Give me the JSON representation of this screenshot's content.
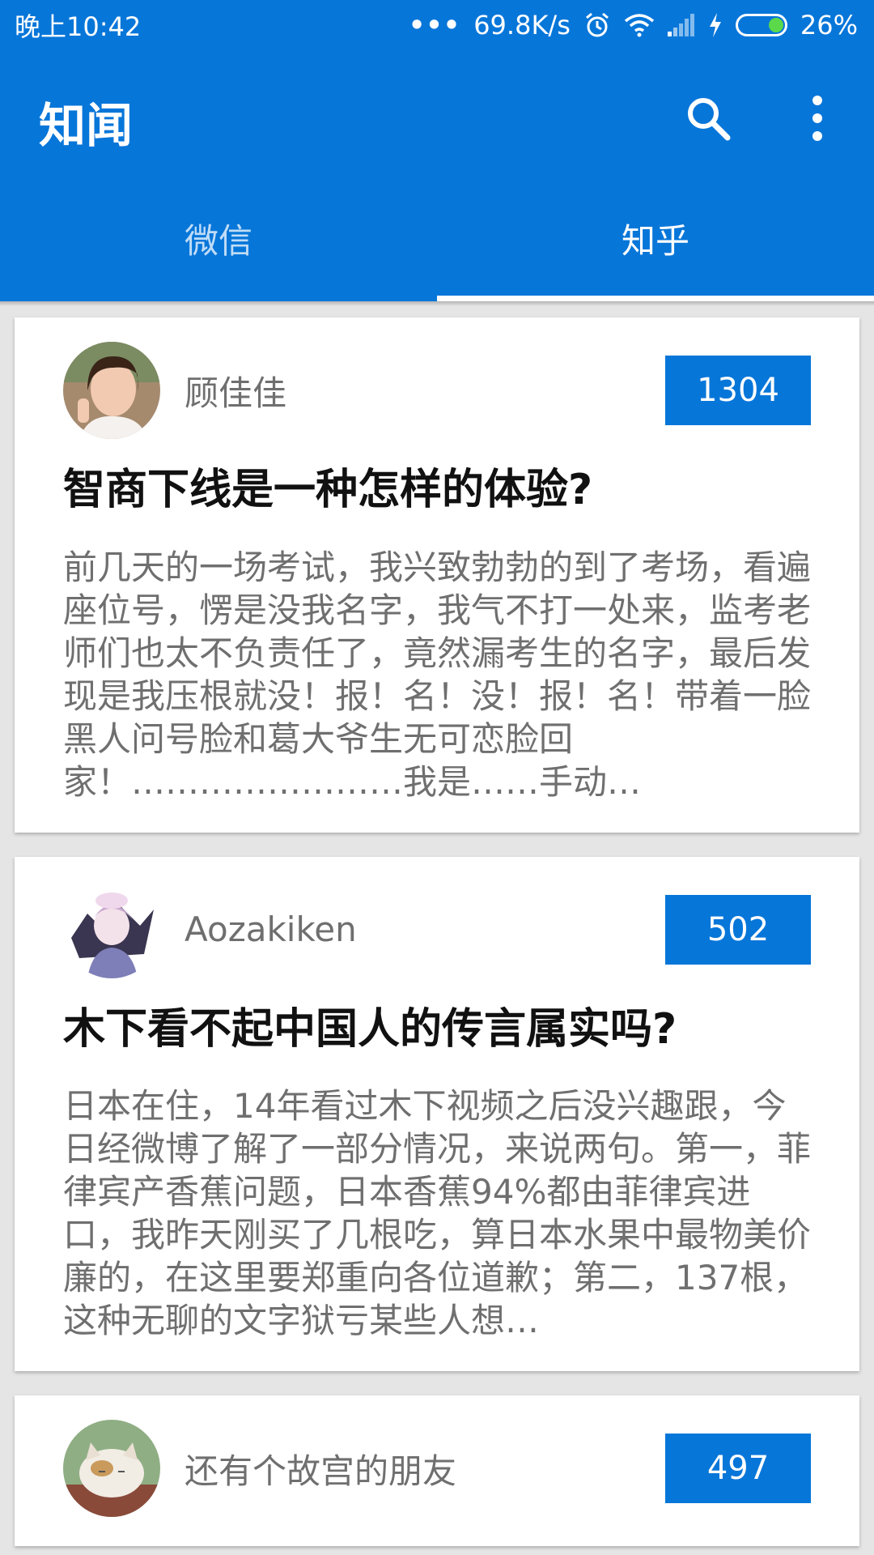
{
  "status_bar": {
    "time": "晚上10:42",
    "dots": "•••",
    "speed": "69.8K/s",
    "battery_percent": "26%",
    "icons": [
      "alarm-icon",
      "wifi-icon",
      "signal-icon",
      "charging-icon",
      "battery-icon"
    ]
  },
  "appbar": {
    "title": "知闻",
    "actions": [
      "search-icon",
      "more-vert-icon"
    ]
  },
  "tabs": [
    {
      "label": "微信",
      "active": false
    },
    {
      "label": "知乎",
      "active": true
    }
  ],
  "colors": {
    "primary": "#0776d9",
    "background": "#e5e5e5",
    "card": "#ffffff",
    "title_text": "#111111",
    "secondary_text": "#6f6f6f"
  },
  "cards": [
    {
      "author": "顾佳佳",
      "count": "1304",
      "title": "智商下线是一种怎样的体验?",
      "excerpt": "前几天的一场考试，我兴致勃勃的到了考场，看遍座位号，愣是没我名字，我气不打一处来，监考老师们也太不负责任了，竟然漏考生的名字，最后发现是我压根就没！报！名！没！报！名！带着一脸黑人问号脸和葛大爷生无可恋脸回家！……………………我是……手动…"
    },
    {
      "author": "Aozakiken",
      "count": "502",
      "title": "木下看不起中国人的传言属实吗?",
      "excerpt": "日本在住，14年看过木下视频之后没兴趣跟，今日经微博了解了一部分情况，来说两句。第一，菲律宾产香蕉问题，日本香蕉94%都由菲律宾进口，我昨天刚买了几根吃，算日本水果中最物美价廉的，在这里要郑重向各位道歉；第二，137根，这种无聊的文字狱亏某些人想…"
    },
    {
      "author": "还有个故宫的朋友",
      "count": "497",
      "title": "",
      "excerpt": ""
    }
  ]
}
